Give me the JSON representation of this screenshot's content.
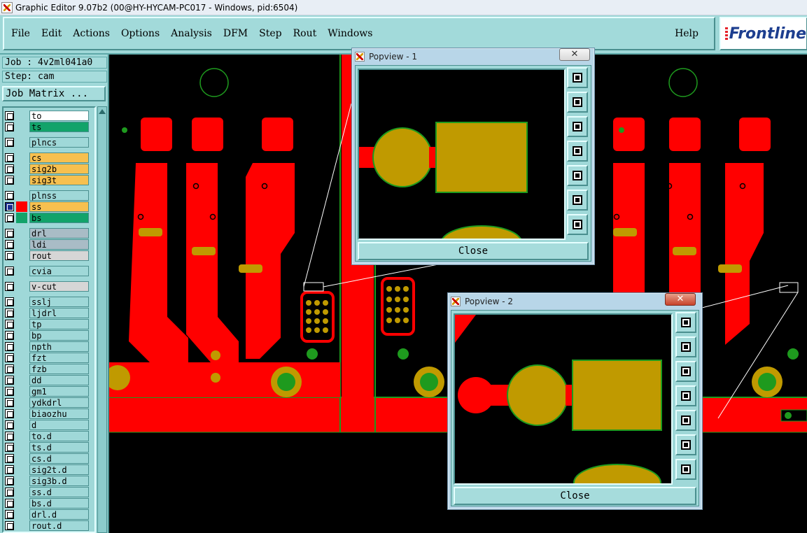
{
  "window": {
    "title": "Graphic Editor 9.07b2 (00@HY-HYCAM-PC017 - Windows, pid:6504)"
  },
  "menu": {
    "items": [
      "File",
      "Edit",
      "Actions",
      "Options",
      "Analysis",
      "DFM",
      "Step",
      "Rout",
      "Windows"
    ],
    "help": "Help",
    "logo": "Frontline"
  },
  "job": {
    "job_label": "Job : 4v2ml041a0",
    "step_label": "Step: cam",
    "matrix_button": "Job Matrix ..."
  },
  "layers": [
    {
      "name": "to",
      "color": "#ffffff"
    },
    {
      "name": "ts",
      "color": "#12a36a"
    },
    {
      "name": "plncs",
      "color": "#9fd8d8"
    },
    {
      "name": "cs",
      "color": "#f7c04f"
    },
    {
      "name": "sig2b",
      "color": "#f7c04f"
    },
    {
      "name": "sig3t",
      "color": "#f7c04f"
    },
    {
      "name": "plnss",
      "color": "#9fd8d8"
    },
    {
      "name": "ss",
      "color": "#f7c04f",
      "selected": true,
      "swatch": "#ff0000"
    },
    {
      "name": "bs",
      "color": "#12a36a",
      "swatch": "#12a36a"
    },
    {
      "name": "drl",
      "color": "#a9bcc6"
    },
    {
      "name": "ldi",
      "color": "#a9bcc6"
    },
    {
      "name": "rout",
      "color": "#d6d6d6"
    },
    {
      "name": "cvia",
      "color": "#9fd8d8"
    },
    {
      "name": "v-cut",
      "color": "#d6d6d6"
    },
    {
      "name": "sslj",
      "color": "#9fd8d8"
    },
    {
      "name": "ljdrl",
      "color": "#9fd8d8"
    },
    {
      "name": "tp",
      "color": "#9fd8d8"
    },
    {
      "name": "bp",
      "color": "#9fd8d8"
    },
    {
      "name": "npth",
      "color": "#9fd8d8"
    },
    {
      "name": "fzt",
      "color": "#9fd8d8"
    },
    {
      "name": "fzb",
      "color": "#9fd8d8"
    },
    {
      "name": "dd",
      "color": "#9fd8d8"
    },
    {
      "name": "gm1",
      "color": "#9fd8d8"
    },
    {
      "name": "ydkdrl",
      "color": "#9fd8d8"
    },
    {
      "name": "biaozhu",
      "color": "#9fd8d8"
    },
    {
      "name": "d",
      "color": "#9fd8d8"
    },
    {
      "name": "to.d",
      "color": "#9fd8d8"
    },
    {
      "name": "ts.d",
      "color": "#9fd8d8"
    },
    {
      "name": "cs.d",
      "color": "#9fd8d8"
    },
    {
      "name": "sig2t.d",
      "color": "#9fd8d8"
    },
    {
      "name": "sig3b.d",
      "color": "#9fd8d8"
    },
    {
      "name": "ss.d",
      "color": "#9fd8d8"
    },
    {
      "name": "bs.d",
      "color": "#9fd8d8"
    },
    {
      "name": "drl.d",
      "color": "#9fd8d8"
    },
    {
      "name": "rout.d",
      "color": "#9fd8d8"
    }
  ],
  "popview1": {
    "title": "Popview - 1",
    "close_label": "Close"
  },
  "popview2": {
    "title": "Popview - 2",
    "close_label": "Close"
  },
  "colors": {
    "copper": "#ff0000",
    "pad": "#c09a00",
    "outline": "#1e9a1e",
    "panel": "#9fd8d8"
  }
}
